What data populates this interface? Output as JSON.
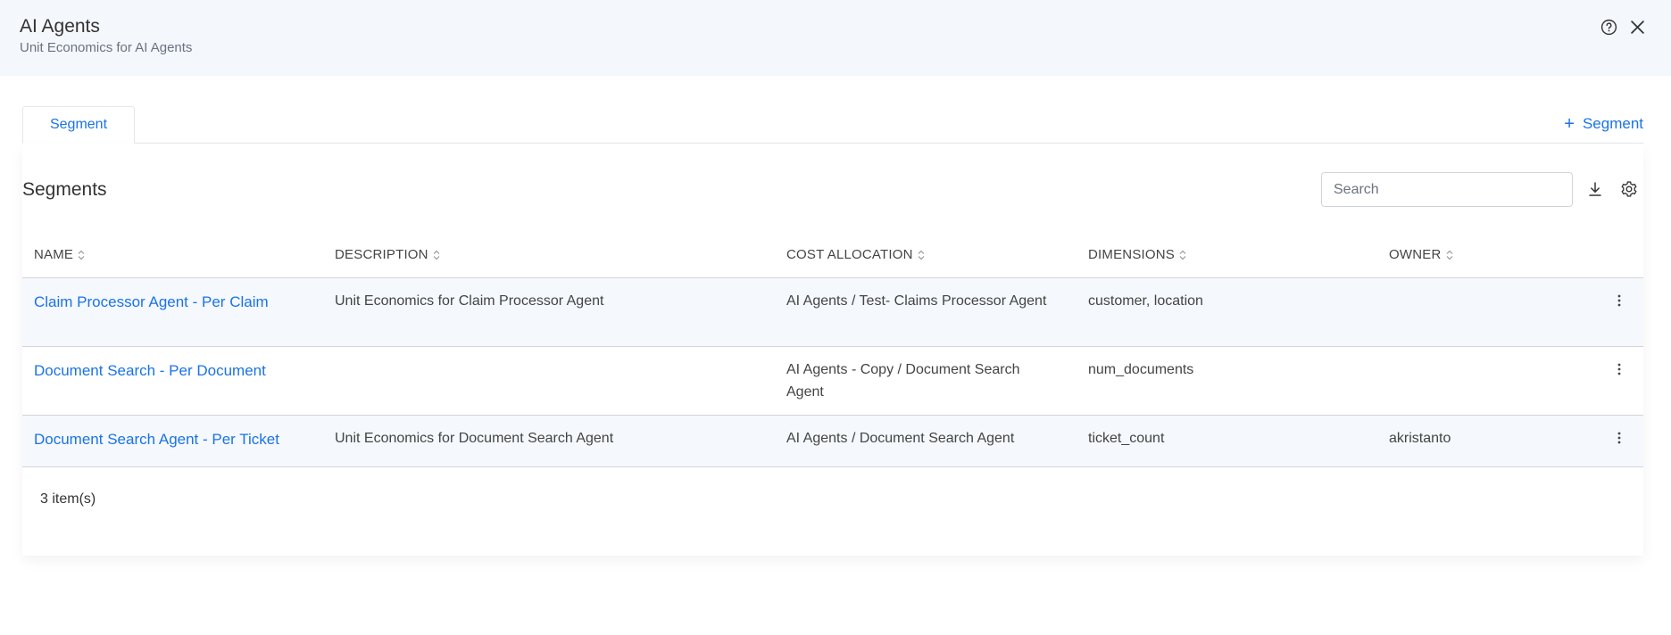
{
  "header": {
    "title": "AI Agents",
    "subtitle": "Unit Economics for AI Agents"
  },
  "tabs": [
    {
      "label": "Segment",
      "active": true
    }
  ],
  "add_segment_label": "Segment",
  "segments": {
    "title": "Segments",
    "search": {
      "placeholder": "Search",
      "value": ""
    },
    "columns": [
      "NAME",
      "DESCRIPTION",
      "COST ALLOCATION",
      "DIMENSIONS",
      "OWNER"
    ],
    "rows": [
      {
        "name": "Claim Processor Agent - Per Claim",
        "description": "Unit Economics for Claim Processor Agent",
        "cost_allocation": "AI Agents / Test- Claims Processor Agent",
        "dimensions": "customer, location",
        "owner": ""
      },
      {
        "name": "Document Search - Per Document",
        "description": "",
        "cost_allocation": "AI Agents - Copy / Document Search Agent",
        "dimensions": "num_documents",
        "owner": ""
      },
      {
        "name": "Document Search Agent - Per Ticket",
        "description": "Unit Economics for Document Search Agent",
        "cost_allocation": "AI Agents / Document Search Agent",
        "dimensions": "ticket_count",
        "owner": "akristanto"
      }
    ],
    "item_count": "3 item(s)"
  },
  "icons": [
    "help-icon",
    "close-icon",
    "plus-icon",
    "download-icon",
    "settings-icon",
    "sort-icon",
    "more-vertical-icon"
  ],
  "colors": {
    "accent": "#1a73e8",
    "header_bg": "#f4f7fb",
    "row_alt_bg": "#f5f8fc"
  }
}
